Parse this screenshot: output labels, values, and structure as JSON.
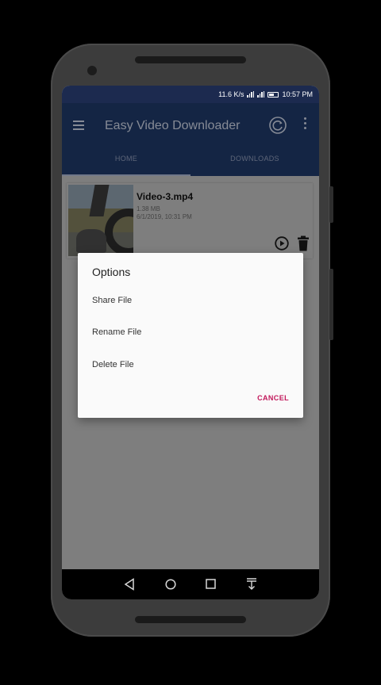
{
  "status_bar": {
    "speed": "11.6 K/s",
    "time": "10:57 PM"
  },
  "app_bar": {
    "title": "Easy Video Downloader",
    "menu_icon": "hamburger-menu-icon",
    "refresh_icon": "refresh-icon",
    "more_icon": "more-vert-icon"
  },
  "tabs": [
    {
      "label": "HOME",
      "active": true
    },
    {
      "label": "DOWNLOADS",
      "active": false
    }
  ],
  "file": {
    "name": "Video-3.mp4",
    "size": "1.38 MB",
    "date": "6/1/2019, 10:31 PM"
  },
  "dialog": {
    "title": "Options",
    "items": [
      "Share File",
      "Rename File",
      "Delete File"
    ],
    "cancel": "CANCEL"
  },
  "colors": {
    "app_bar": "#1f3866",
    "status_bar": "#1c2a4f",
    "accent": "#c2185b"
  }
}
